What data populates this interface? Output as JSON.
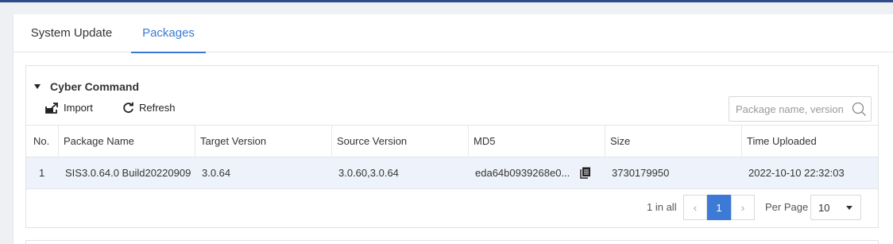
{
  "tabs": [
    {
      "label": "System Update",
      "active": false
    },
    {
      "label": "Packages",
      "active": true
    }
  ],
  "colors": {
    "accent": "#3c7ad6",
    "topbar": "#2f4a8a",
    "selected_row": "#eef3fb"
  },
  "section": {
    "title": "Cyber Command",
    "expanded": true
  },
  "toolbar": {
    "import_label": "Import",
    "import_icon": "import-icon",
    "refresh_label": "Refresh",
    "refresh_icon": "refresh-icon"
  },
  "search": {
    "placeholder": "Package name, version",
    "value": "",
    "icon": "search-icon"
  },
  "table": {
    "columns": [
      "No.",
      "Package Name",
      "Target Version",
      "Source Version",
      "MD5",
      "Size",
      "Time Uploaded"
    ],
    "rows": [
      {
        "no": "1",
        "package_name": "SIS3.0.64.0 Build20220909",
        "target_version": "3.0.64",
        "source_version": "3.0.60,3.0.64",
        "md5": "eda64b0939268e0...",
        "size": "3730179950",
        "time_uploaded": "2022-10-10 22:32:03"
      }
    ]
  },
  "pagination": {
    "total_label": "1 in all",
    "current_page": "1",
    "per_page_label": "Per Page",
    "per_page_value": "10"
  }
}
